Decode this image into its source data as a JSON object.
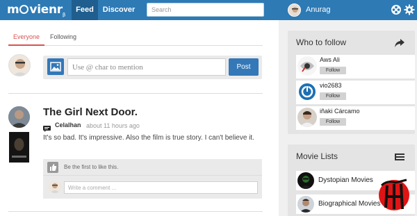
{
  "app": {
    "logo_text": "movienr",
    "logo_suffix": "β",
    "brand_color": "#2d7ab5"
  },
  "nav": {
    "feed_label": "Feed",
    "discover_label": "Discover",
    "search_placeholder": "Search",
    "user_name": "Anurag"
  },
  "feed": {
    "tabs": [
      {
        "label": "Everyone",
        "active": true
      },
      {
        "label": "Following",
        "active": false
      }
    ],
    "composer": {
      "placeholder": "Use @ char to mention",
      "post_label": "Post"
    },
    "post": {
      "title": "The Girl Next Door.",
      "author": "Celalhan",
      "time": "about 11 hours ago",
      "text": "It's so bad. It's impressive. Also the film is true story. I can't believe it.",
      "like_text": "Be the first to like this.",
      "comment_placeholder": "Write a comment ..."
    }
  },
  "sidebar": {
    "who_to_follow": {
      "title": "Who to follow",
      "users": [
        {
          "name": "Aws Ali",
          "button": "Follow"
        },
        {
          "name": "vio2683",
          "button": "Follow"
        },
        {
          "name": "iñaki Cárcamo",
          "button": "Follow"
        }
      ]
    },
    "movie_lists": {
      "title": "Movie Lists",
      "lists": [
        {
          "name": "Dystopian Movies"
        },
        {
          "name": "Biographical Movies"
        }
      ]
    }
  }
}
